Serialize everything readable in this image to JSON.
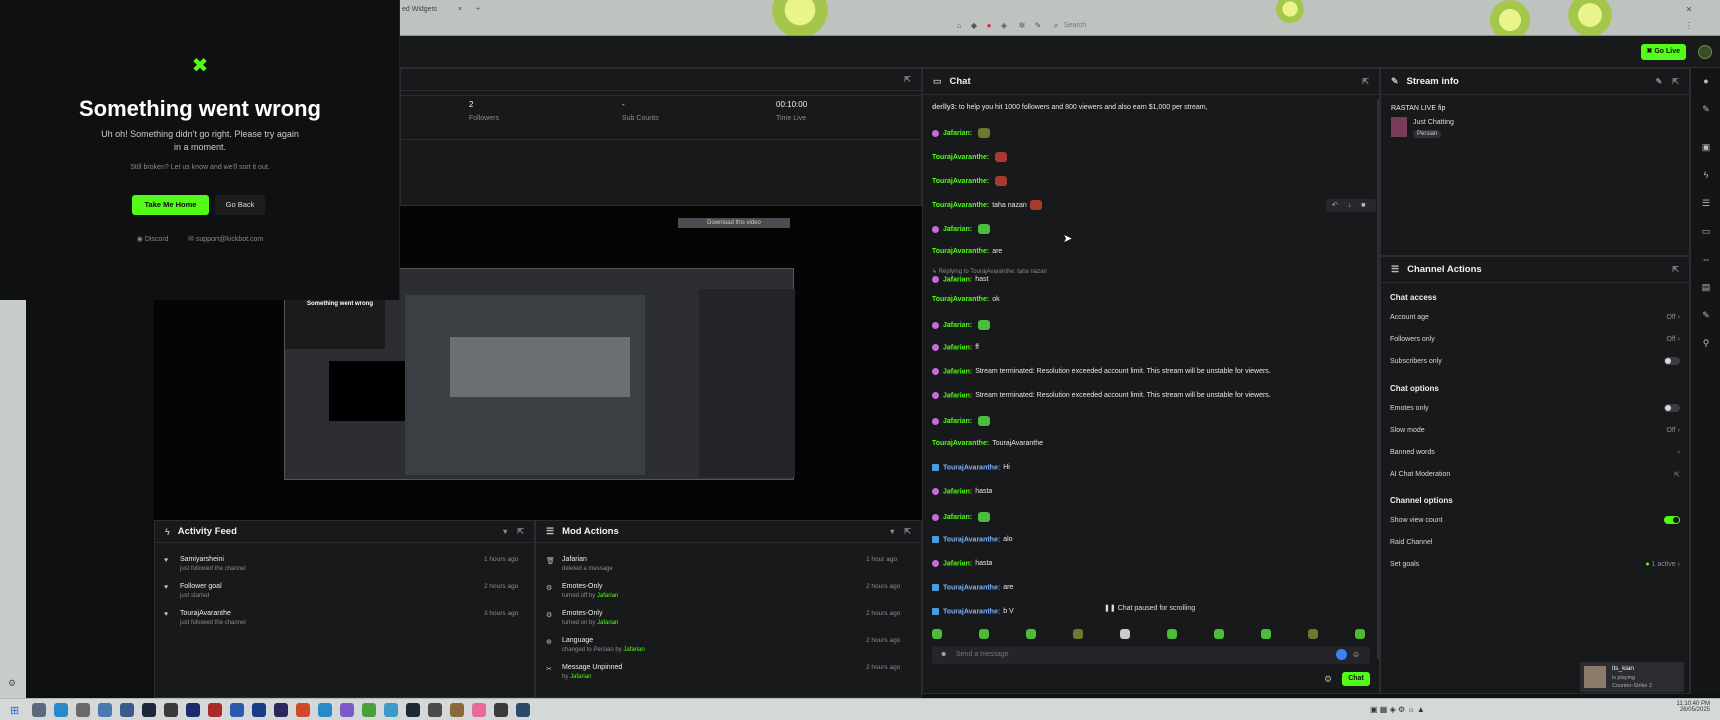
{
  "browser": {
    "tab_label": "ed Widgets",
    "tab_close": "×",
    "new_tab": "+",
    "search_placeholder": "Search"
  },
  "header": {
    "go_live_label": "Go Live"
  },
  "error": {
    "title": "Something went wrong",
    "subtitle": "Uh oh! Something didn't go right. Please try again in a moment.",
    "sub2": "Still broken? Let us know and we'll sort it out.",
    "home_button": "Take Me Home",
    "back_button": "Go Back",
    "discord": "Discord",
    "email": "support@kickbot.com"
  },
  "stats": [
    {
      "value": "2",
      "label": "Followers"
    },
    {
      "value": "-",
      "label": "Sub Counts"
    },
    {
      "value": "00:10:00",
      "label": "Time Live"
    }
  ],
  "video": {
    "download_label": "Download this video",
    "inner_title": "Something went wrong"
  },
  "chat": {
    "title": "Chat",
    "first_line_user": "derlly3:",
    "first_line_text": "to help you hit 1000 followers and 800 viewers and also earn $1,000 per stream,",
    "messages": [
      {
        "user": "Jafarian:",
        "text": "",
        "emote": "olive",
        "badge": "sub"
      },
      {
        "user": "TourajAvaranthe:",
        "text": "",
        "emote": "red",
        "badge": ""
      },
      {
        "user": "TourajAvaranthe:",
        "text": "",
        "emote": "red",
        "badge": ""
      },
      {
        "user": "TourajAvaranthe:",
        "text": "taha nazan",
        "emote": "red",
        "badge": ""
      },
      {
        "user": "Jafarian:",
        "text": "",
        "emote": "green",
        "badge": "sub"
      },
      {
        "user": "TourajAvaranthe:",
        "text": "are",
        "emote": "",
        "badge": ""
      },
      {
        "user": "Jafarian:",
        "text": "hast",
        "emote": "",
        "badge": "sub"
      },
      {
        "user": "TourajAvaranthe:",
        "text": "ok",
        "emote": "",
        "badge": ""
      },
      {
        "user": "Jafarian:",
        "text": "",
        "emote": "green",
        "badge": "sub"
      },
      {
        "user": "Jafarian:",
        "text": "ff",
        "emote": "",
        "badge": "sub"
      },
      {
        "user": "Jafarian:",
        "text": "Stream terminated: Resolution exceeded account limit. This stream will be unstable for viewers.",
        "emote": "",
        "badge": "sub"
      },
      {
        "user": "Jafarian:",
        "text": "Stream terminated: Resolution exceeded account limit. This stream will be unstable for viewers.",
        "emote": "",
        "badge": "sub"
      },
      {
        "user": "Jafarian:",
        "text": "",
        "emote": "green",
        "badge": "sub"
      },
      {
        "user": "TourajAvaranthe:",
        "text": "TourajAvaranthe",
        "emote": "",
        "badge": ""
      },
      {
        "user": "TourajAvaranthe:",
        "text": "Hi",
        "emote": "",
        "badge": "blue"
      },
      {
        "user": "Jafarian:",
        "text": "hasta",
        "emote": "",
        "badge": "sub"
      },
      {
        "user": "Jafarian:",
        "text": "",
        "emote": "green",
        "badge": "sub"
      },
      {
        "user": "TourajAvaranthe:",
        "text": "alo",
        "emote": "",
        "badge": "blue"
      },
      {
        "user": "Jafarian:",
        "text": "hasta",
        "emote": "",
        "badge": "sub"
      },
      {
        "user": "TourajAvaranthe:",
        "text": "are",
        "emote": "",
        "badge": "blue"
      },
      {
        "user": "TourajAvaranthe:",
        "text": "b V",
        "emote": "",
        "badge": "blue"
      }
    ],
    "reply_hint": "Replying to TourajAvaranthe: taha nazan",
    "paused_label": "Chat paused for scrolling",
    "input_placeholder": "Send a message",
    "send_label": "Chat"
  },
  "stream_info": {
    "title": "Stream info",
    "stream_title": "RASTAN LIVE fip",
    "category": "Just Chatting",
    "tag": "Persian"
  },
  "channel_actions": {
    "title": "Channel Actions",
    "chat_access_heading": "Chat access",
    "account_age": "Account age",
    "account_age_val": "Off",
    "followers_only": "Followers only",
    "followers_only_val": "Off",
    "subscribers_only": "Subscribers only",
    "chat_options_heading": "Chat options",
    "emotes_only": "Emotes only",
    "slow_mode": "Slow mode",
    "slow_mode_val": "Off",
    "banned_words": "Banned words",
    "ai_moderation": "AI Chat Moderation",
    "channel_options_heading": "Channel options",
    "show_view_count": "Show view count",
    "raid_channel": "Raid Channel",
    "set_goals": "Set goals",
    "set_goals_val": "1 active"
  },
  "activity": {
    "title": "Activity Feed",
    "items": [
      {
        "name": "Samiyarsheini",
        "detail": "just followed the channel",
        "time": "1 hours ago"
      },
      {
        "name": "Follower goal",
        "detail": "just started",
        "time": "2 hours ago"
      },
      {
        "name": "TourajAvaranthe",
        "detail": "just followed the channel",
        "time": "3 hours ago"
      }
    ]
  },
  "mod_actions": {
    "title": "Mod Actions",
    "items": [
      {
        "name": "Jafarian",
        "detail": "deleted a message",
        "time": "1 hour ago"
      },
      {
        "name": "Emotes-Only",
        "detail": "turned off by",
        "who": "Jafarian",
        "time": "2 hours ago"
      },
      {
        "name": "Emotes-Only",
        "detail": "turned on by",
        "who": "Jafarian",
        "time": "2 hours ago"
      },
      {
        "name": "Language",
        "detail": "changed to Persian by",
        "who": "Jafarian",
        "time": "2 hours ago"
      },
      {
        "name": "Message Unpinned",
        "detail": "by",
        "who": "Jafarian",
        "time": "2 hours ago"
      }
    ]
  },
  "notification": {
    "name": "its_kian",
    "line2": "is playing",
    "line3": "Counter-Strike 2"
  },
  "clock": {
    "time": "11:10:40 PM",
    "date": "26/05/2025"
  },
  "colors": {
    "accent": "#53fc18",
    "panel": "#18191b",
    "bg": "#101113"
  }
}
